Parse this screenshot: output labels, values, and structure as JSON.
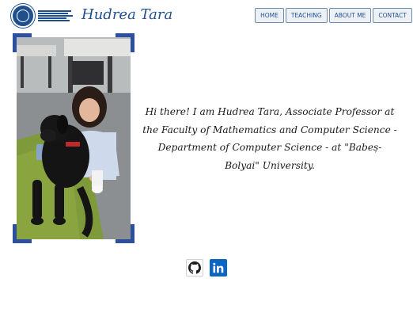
{
  "header": {
    "logo_text": "UNIVERSITATEA BABEȘ-BOLYAI",
    "brand_name": "Hudrea Tara",
    "nav": [
      {
        "label": "HOME"
      },
      {
        "label": "TEACHING"
      },
      {
        "label": "ABOUT ME"
      },
      {
        "label": "CONTACT"
      }
    ]
  },
  "hero": {
    "photo_alt": "Hudrea Tara with a black dog",
    "intro_text": "Hi there! I am Hudrea Tara, Associate Professor at the Faculty of Mathematics and Computer Science - Department of Computer Science - at \"Babeș-Bolyai\" University."
  },
  "socials": [
    {
      "icon": "github-icon",
      "color": "#1b1f23"
    },
    {
      "icon": "linkedin-icon",
      "color": "#0a66c2"
    }
  ],
  "colors": {
    "brand": "#1f4f8f",
    "frame_accent": "#2c4fa0",
    "nav_bg": "#edf1f5",
    "nav_border": "#6d8daa"
  }
}
